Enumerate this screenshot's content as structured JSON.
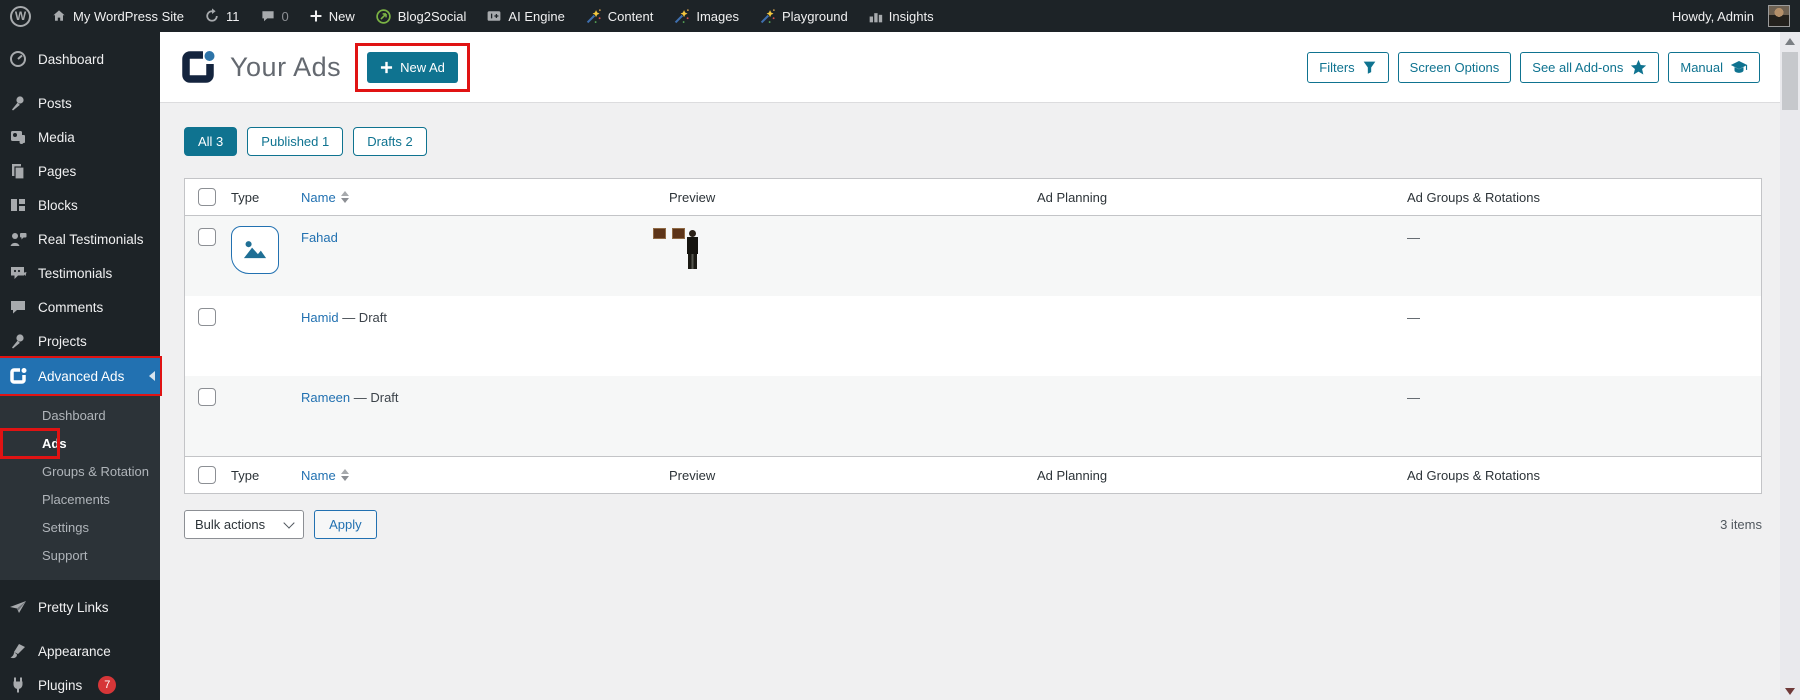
{
  "admin_bar": {
    "site_name": "My WordPress Site",
    "updates_count": "11",
    "comments_count": "0",
    "new_label": "New",
    "blog2social": "Blog2Social",
    "ai_engine": "AI Engine",
    "content": "Content",
    "images": "Images",
    "playground": "Playground",
    "insights": "Insights",
    "howdy": "Howdy, Admin"
  },
  "sidebar": {
    "dashboard": "Dashboard",
    "posts": "Posts",
    "media": "Media",
    "pages": "Pages",
    "blocks": "Blocks",
    "real_testimonials": "Real Testimonials",
    "testimonials": "Testimonials",
    "comments": "Comments",
    "projects": "Projects",
    "advanced_ads": "Advanced Ads",
    "submenu": {
      "dashboard": "Dashboard",
      "ads": "Ads",
      "groups": "Groups & Rotation",
      "placements": "Placements",
      "settings": "Settings",
      "support": "Support"
    },
    "pretty_links": "Pretty Links",
    "appearance": "Appearance",
    "plugins": "Plugins",
    "plugins_badge": "7"
  },
  "header": {
    "title": "Your Ads",
    "new_ad": "New Ad",
    "filters": "Filters",
    "screen_options": "Screen Options",
    "see_all_addons": "See all Add-ons",
    "manual": "Manual"
  },
  "tabs": {
    "all": "All 3",
    "published": "Published 1",
    "drafts": "Drafts 2"
  },
  "table": {
    "col_type": "Type",
    "col_name": "Name",
    "col_preview": "Preview",
    "col_planning": "Ad Planning",
    "col_groups": "Ad Groups & Rotations",
    "rows": [
      {
        "name": "Fahad",
        "status": "",
        "groups": "—"
      },
      {
        "name": "Hamid",
        "status": " — Draft",
        "groups": "—"
      },
      {
        "name": "Rameen",
        "status": " — Draft",
        "groups": "—"
      }
    ]
  },
  "footer": {
    "bulk_actions": "Bulk actions",
    "apply": "Apply",
    "count": "3 items"
  },
  "colors": {
    "accent_teal": "#0f7390",
    "link_blue": "#2271b1",
    "annotation_red": "#e01313",
    "badge_red": "#d63638",
    "adminbar_bg": "#1d2327",
    "submenu_bg": "#2c3338",
    "page_bg": "#f0f0f1",
    "row_stripe": "#f6f7f7"
  }
}
